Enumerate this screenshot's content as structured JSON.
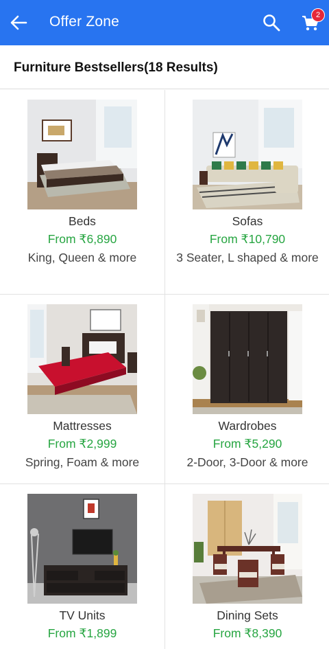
{
  "appbar": {
    "title": "Offer Zone",
    "cart_count": "2",
    "color": "#2874f0",
    "back_icon": "arrow-left-icon",
    "search_icon": "search-icon",
    "cart_icon": "cart-icon"
  },
  "section": {
    "heading": "Furniture Bestsellers(18 Results)"
  },
  "products": [
    {
      "name": "Beds",
      "price": "From ₹6,890",
      "desc": "King, Queen & more"
    },
    {
      "name": "Sofas",
      "price": "From ₹10,790",
      "desc": "3 Seater, L shaped & more"
    },
    {
      "name": "Mattresses",
      "price": "From ₹2,999",
      "desc": "Spring, Foam & more"
    },
    {
      "name": "Wardrobes",
      "price": "From ₹5,290",
      "desc": "2-Door, 3-Door & more"
    },
    {
      "name": "TV Units",
      "price": "From ₹1,899",
      "desc": ""
    },
    {
      "name": "Dining Sets",
      "price": "From ₹8,390",
      "desc": ""
    }
  ],
  "colors": {
    "price": "#26a541",
    "badge": "#e5293a"
  }
}
